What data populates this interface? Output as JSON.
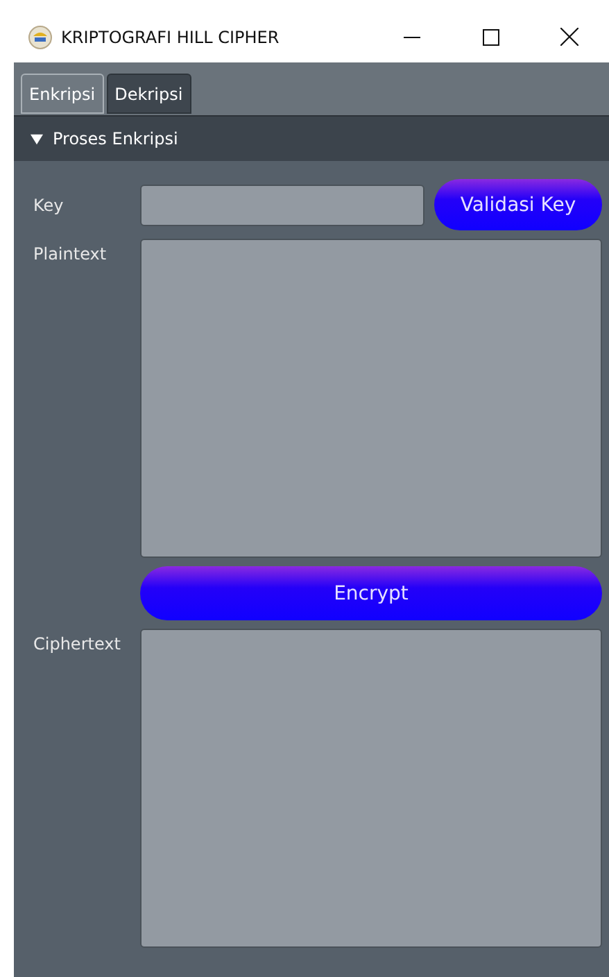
{
  "window": {
    "title": "KRIPTOGRAFI HILL CIPHER"
  },
  "tabs": [
    {
      "label": "Enkripsi",
      "selected": true
    },
    {
      "label": "Dekripsi",
      "selected": false
    }
  ],
  "section": {
    "title": "Proses Enkripsi",
    "expanded": true
  },
  "key": {
    "label": "Key"
  },
  "validate_button": "Validasi Key",
  "plaintext": {
    "label": "Plaintext"
  },
  "encrypt_button": "Encrypt",
  "ciphertext": {
    "label": "Ciphertext"
  }
}
